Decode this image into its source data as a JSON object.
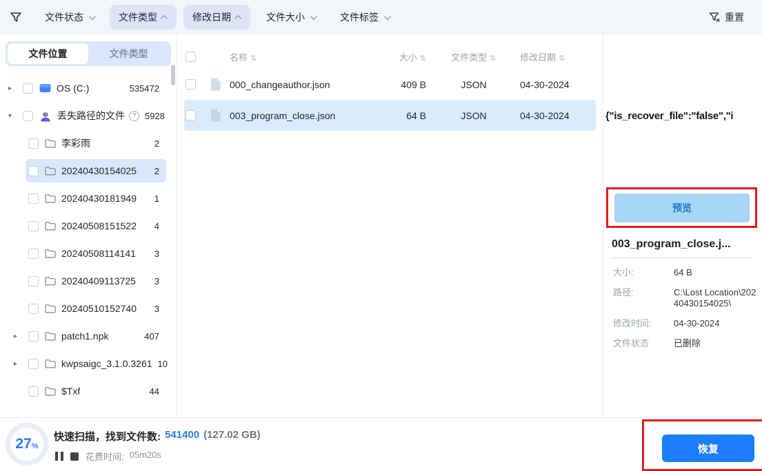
{
  "toolbar": {
    "filters": [
      {
        "label": "文件状态",
        "caret": "down",
        "active": false
      },
      {
        "label": "文件类型",
        "caret": "up",
        "active": true
      },
      {
        "label": "修改日期",
        "caret": "up",
        "active": true
      },
      {
        "label": "文件大小",
        "caret": "down",
        "active": false
      },
      {
        "label": "文件标签",
        "caret": "down",
        "active": false
      }
    ],
    "reset_label": "重置"
  },
  "sidebar": {
    "tabs": [
      {
        "label": "文件位置",
        "active": true
      },
      {
        "label": "文件类型",
        "active": false
      }
    ],
    "tree": [
      {
        "label": "OS (C:)",
        "count": "535472",
        "icon": "drive-icon"
      },
      {
        "label": "丢失路径的文件",
        "count": "5928",
        "icon": "lost-user-icon",
        "help": true
      },
      {
        "label": "李彩雨",
        "count": "2",
        "icon": "folder-icon"
      },
      {
        "label": "20240430154025",
        "count": "2",
        "icon": "folder-icon",
        "selected": true
      },
      {
        "label": "20240430181949",
        "count": "1",
        "icon": "folder-icon"
      },
      {
        "label": "20240508151522",
        "count": "4",
        "icon": "folder-icon"
      },
      {
        "label": "20240508114141",
        "count": "3",
        "icon": "folder-icon"
      },
      {
        "label": "20240409113725",
        "count": "3",
        "icon": "folder-icon"
      },
      {
        "label": "20240510152740",
        "count": "3",
        "icon": "folder-icon"
      },
      {
        "label": "patch1.npk",
        "count": "407",
        "icon": "folder-icon"
      },
      {
        "label": "kwpsaigc_3.1.0.3261",
        "count": "10",
        "icon": "folder-icon"
      },
      {
        "label": "$Txf",
        "count": "44",
        "icon": "folder-icon"
      }
    ]
  },
  "table": {
    "headers": {
      "name": "名称",
      "size": "大小",
      "type": "文件类型",
      "date": "修改日期"
    },
    "rows": [
      {
        "name": "000_changeauthor.json",
        "size": "409 B",
        "type": "JSON",
        "date": "04-30-2024",
        "selected": false
      },
      {
        "name": "003_program_close.json",
        "size": "64 B",
        "type": "JSON",
        "date": "04-30-2024",
        "selected": true
      }
    ]
  },
  "preview": {
    "content": "{\"is_recover_file\":\"false\",\"i",
    "button_label": "预览",
    "file_name": "003_program_close.j...",
    "details": [
      {
        "label": "大小:",
        "value": "64 B"
      },
      {
        "label": "路径:",
        "value": "C:\\Lost Location\\20240430154025\\"
      },
      {
        "label": "修改时间:",
        "value": "04-30-2024"
      },
      {
        "label": "文件状态",
        "value": "已删除"
      }
    ]
  },
  "statusbar": {
    "progress": "27",
    "progress_unit": "%",
    "scan_label": "快速扫描，找到文件数:",
    "file_count": "541400",
    "total_size": "(127.02 GB)",
    "time_label": "花费时间:",
    "time_value": "05m20s",
    "recover_label": "恢复"
  },
  "colors": {
    "accent_blue": "#2a7df0",
    "recover_button": "#1b7df8",
    "preview_button_bg": "#a9d6f4",
    "preview_button_text": "#1778d0",
    "selected_row": "#d9ecfb",
    "selected_tree_row": "#d9e8fa",
    "filter_pill": "#dde4f7",
    "annotation_red": "#e11c1c",
    "toolbar_bg": "#f2f5fa"
  }
}
